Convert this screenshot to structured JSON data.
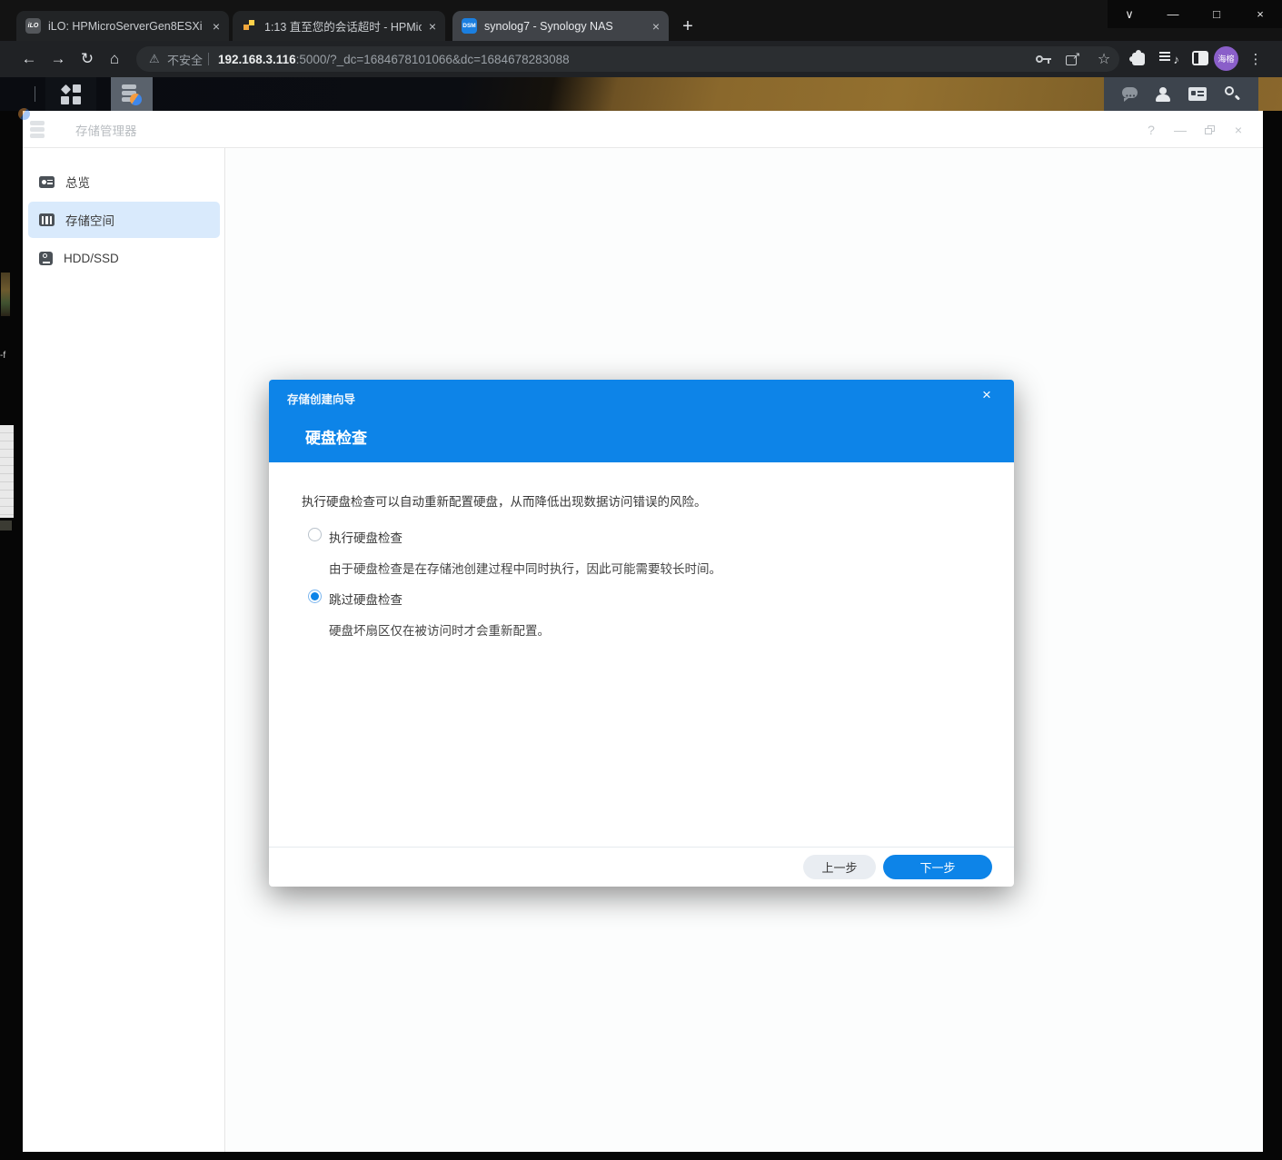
{
  "browser": {
    "window_controls": {
      "chevron": "∨",
      "minimize": "—",
      "maximize": "□",
      "close": "×"
    },
    "tabs": [
      {
        "favicon_label": "iLO",
        "title": "iLO: HPMicroServerGen8ESXi -",
        "close": "×",
        "active": false
      },
      {
        "favicon_label": "",
        "title": "1:13 直至您的会话超时 - HPMic",
        "close": "×",
        "active": false
      },
      {
        "favicon_label": "DSM",
        "title": "synolog7 - Synology NAS",
        "close": "×",
        "active": true
      }
    ],
    "new_tab": "+",
    "toolbar": {
      "back": "←",
      "forward": "→",
      "reload": "↻",
      "home": "⌂",
      "warning": "⚠",
      "security_label": "不安全",
      "url_host": "192.168.3.116",
      "url_rest": ":5000/?_dc=1684678101066&dc=1684678283088",
      "star": "☆",
      "menu": "⋮",
      "media_note": "♪",
      "avatar_label": "海榕"
    }
  },
  "dsm": {
    "taskbar": {
      "icons": [
        "main-menu",
        "storage-manager",
        "chat",
        "user",
        "widgets",
        "search"
      ]
    },
    "window": {
      "title": "存储管理器",
      "help": "?",
      "minimize": "—",
      "close": "×"
    },
    "sidebar": {
      "items": [
        {
          "label": "总览",
          "icon": "overview-icon",
          "selected": false
        },
        {
          "label": "存储空间",
          "icon": "volume-icon",
          "selected": true
        },
        {
          "label": "HDD/SSD",
          "icon": "hdd-icon",
          "selected": false
        }
      ]
    },
    "wizard": {
      "title": "存储创建向导",
      "close": "×",
      "step_title": "硬盘检查",
      "intro": "执行硬盘检查可以自动重新配置硬盘，从而降低出现数据访问错误的风险。",
      "options": [
        {
          "label": "执行硬盘检查",
          "desc": "由于硬盘检查是在存储池创建过程中同时执行，因此可能需要较长时间。",
          "selected": false
        },
        {
          "label": "跳过硬盘检查",
          "desc": "硬盘坏扇区仅在被访问时才会重新配置。",
          "selected": true
        }
      ],
      "back_label": "上一步",
      "next_label": "下一步"
    }
  },
  "colors": {
    "accent": "#0d84e8",
    "dialog_header": "#0d84e8",
    "sidebar_selected_bg": "#d9eafc"
  }
}
